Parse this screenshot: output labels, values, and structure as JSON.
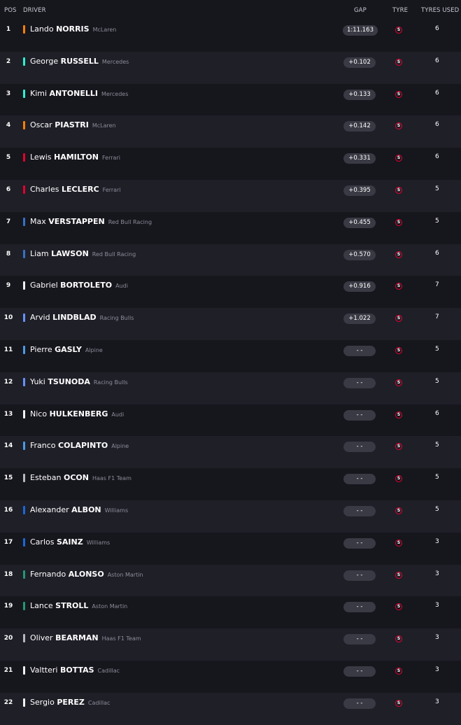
{
  "header": {
    "pos": "POS",
    "driver": "DRIVER",
    "gap": "GAP",
    "tyre": "TYRE",
    "tyres_used": "TYRES USED"
  },
  "tyre_icon_letter": "S",
  "rows": [
    {
      "pos": "1",
      "first": "Lando",
      "last": "NORRIS",
      "team": "McLaren",
      "team_color": "#ff8000",
      "gap": "1:11.163",
      "used": "6"
    },
    {
      "pos": "2",
      "first": "George",
      "last": "RUSSELL",
      "team": "Mercedes",
      "team_color": "#27f4d2",
      "gap": "+0.102",
      "used": "6"
    },
    {
      "pos": "3",
      "first": "Kimi",
      "last": "ANTONELLI",
      "team": "Mercedes",
      "team_color": "#27f4d2",
      "gap": "+0.133",
      "used": "6"
    },
    {
      "pos": "4",
      "first": "Oscar",
      "last": "PIASTRI",
      "team": "McLaren",
      "team_color": "#ff8000",
      "gap": "+0.142",
      "used": "6"
    },
    {
      "pos": "5",
      "first": "Lewis",
      "last": "HAMILTON",
      "team": "Ferrari",
      "team_color": "#e8002d",
      "gap": "+0.331",
      "used": "6"
    },
    {
      "pos": "6",
      "first": "Charles",
      "last": "LECLERC",
      "team": "Ferrari",
      "team_color": "#e8002d",
      "gap": "+0.395",
      "used": "5"
    },
    {
      "pos": "7",
      "first": "Max",
      "last": "VERSTAPPEN",
      "team": "Red Bull Racing",
      "team_color": "#3671c6",
      "gap": "+0.455",
      "used": "5"
    },
    {
      "pos": "8",
      "first": "Liam",
      "last": "LAWSON",
      "team": "Red Bull Racing",
      "team_color": "#3671c6",
      "gap": "+0.570",
      "used": "6"
    },
    {
      "pos": "9",
      "first": "Gabriel",
      "last": "BORTOLETO",
      "team": "Audi",
      "team_color": "#f2f2f2",
      "gap": "+0.916",
      "used": "7"
    },
    {
      "pos": "10",
      "first": "Arvid",
      "last": "LINDBLAD",
      "team": "Racing Bulls",
      "team_color": "#6692ff",
      "gap": "+1.022",
      "used": "7"
    },
    {
      "pos": "11",
      "first": "Pierre",
      "last": "GASLY",
      "team": "Alpine",
      "team_color": "#4a9be8",
      "gap": "- -",
      "used": "5"
    },
    {
      "pos": "12",
      "first": "Yuki",
      "last": "TSUNODA",
      "team": "Racing Bulls",
      "team_color": "#6692ff",
      "gap": "- -",
      "used": "5"
    },
    {
      "pos": "13",
      "first": "Nico",
      "last": "HULKENBERG",
      "team": "Audi",
      "team_color": "#f2f2f2",
      "gap": "- -",
      "used": "6"
    },
    {
      "pos": "14",
      "first": "Franco",
      "last": "COLAPINTO",
      "team": "Alpine",
      "team_color": "#4a9be8",
      "gap": "- -",
      "used": "5"
    },
    {
      "pos": "15",
      "first": "Esteban",
      "last": "OCON",
      "team": "Haas F1 Team",
      "team_color": "#b6babd",
      "gap": "- -",
      "used": "5"
    },
    {
      "pos": "16",
      "first": "Alexander",
      "last": "ALBON",
      "team": "Williams",
      "team_color": "#1868db",
      "gap": "- -",
      "used": "5"
    },
    {
      "pos": "17",
      "first": "Carlos",
      "last": "SAINZ",
      "team": "Williams",
      "team_color": "#1868db",
      "gap": "- -",
      "used": "3"
    },
    {
      "pos": "18",
      "first": "Fernando",
      "last": "ALONSO",
      "team": "Aston Martin",
      "team_color": "#229971",
      "gap": "- -",
      "used": "3"
    },
    {
      "pos": "19",
      "first": "Lance",
      "last": "STROLL",
      "team": "Aston Martin",
      "team_color": "#229971",
      "gap": "- -",
      "used": "3"
    },
    {
      "pos": "20",
      "first": "Oliver",
      "last": "BEARMAN",
      "team": "Haas F1 Team",
      "team_color": "#b6babd",
      "gap": "- -",
      "used": "3"
    },
    {
      "pos": "21",
      "first": "Valtteri",
      "last": "BOTTAS",
      "team": "Cadillac",
      "team_color": "#f2f2f2",
      "gap": "- -",
      "used": "3"
    },
    {
      "pos": "22",
      "first": "Sergio",
      "last": "PEREZ",
      "team": "Cadillac",
      "team_color": "#f2f2f2",
      "gap": "- -",
      "used": "3"
    }
  ]
}
